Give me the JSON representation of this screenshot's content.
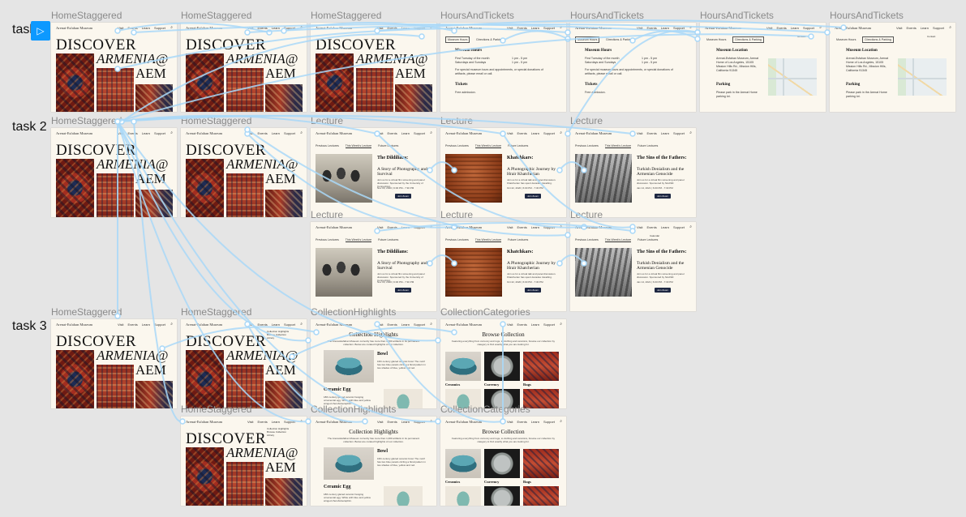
{
  "rows": [
    {
      "id": "task1",
      "label": "task 1"
    },
    {
      "id": "task2",
      "label": "task 2"
    },
    {
      "id": "task3",
      "label": "task 3"
    }
  ],
  "site": {
    "brand": "Arenat-Esfahan Museum",
    "nav": [
      "Visit",
      "Events",
      "Learn",
      "Support"
    ],
    "search_icon": "search-icon"
  },
  "home": {
    "line1": "DISCOVER",
    "line2": "ARMENIA@",
    "line3": "AEM"
  },
  "hours": {
    "tabs": [
      "Museum Hours",
      "Directions & Parking"
    ],
    "museum_hours_title": "Museum Hours",
    "row1_label": "First Tuesday of the month",
    "row1_time": "1 pm - 5 pm",
    "row2_label": "Saturdays and Sundays",
    "row2_time": "1 pm - 5 pm",
    "note": "For special museum tours and appointments, or special donations of artifacts, please email or call.",
    "tickets_title": "Tickets",
    "tickets_text": "Free admission.",
    "location_title": "Museum Location",
    "location_text": "Arenat-Esfahan Museum, Arenat Home of Los Angeles, 15105 Mission Hills Rd., Mission Hills, California 91345",
    "parking_title": "Parking",
    "parking_text": "Please park in the Arenat Home parking lot."
  },
  "lecture": {
    "tabs": [
      "Previous Lectures",
      "This Week's Lecture",
      "Future Lectures"
    ],
    "join": "Join Zoom",
    "items": [
      {
        "title": "The Dildilians:",
        "subtitle": "A Story of Photography and Survival",
        "date": "Nov 03, 2020 | 6:00 PM - 7:30 PM",
        "body": "Join us for a virtual film screening and panel discussion. Sponsored by the University of Connecticut."
      },
      {
        "title": "Khatchkars:",
        "subtitle": "A Photographic Journey by Hrair Khatcherian",
        "date": "Oct 22, 2020 | 6:00 PM - 7:30 PM",
        "body": "Join us for a virtual talk and panel discussion. Khatcherian has spent decades travelling."
      },
      {
        "title": "The Sins of the Fathers:",
        "subtitle": "Turkish Denialism and the Armenian Genocide",
        "date": "Jan 14, 2021 | 6:00 PM - 7:30 PM",
        "body": "Join us for a virtual film screening and panel discussion. Sponsored by NAASR."
      }
    ]
  },
  "collection": {
    "highlights_title": "Collection Highlights",
    "highlights_intro": "The Arenat-Esfahan Museum currently has more than 1,000 artifacts in its permanent collection. Below are curated highlights of our collection.",
    "items": [
      {
        "name": "Bowl",
        "text": "16th century glazed ceramic bowl. The motif has two blue panels circling a floral pattern in two shades of blue, yellow and red."
      },
      {
        "name": "Ceramic Egg",
        "text": "18th century glazed ceramic hanging ornamental egg. White with blue and yellow winged cherubs/seraphim."
      }
    ],
    "browse_title": "Browse Collection",
    "browse_intro": "Featuring everything from currency and rugs, to clothing and ceramics, browse our collection by category to find exactly what you are looking for.",
    "categories": [
      "Ceramics",
      "Currency",
      "Rugs"
    ],
    "learn_menu": [
      "Collection Highlights",
      "Browse Collection",
      "Library"
    ]
  },
  "events_menu": [
    "Calendar"
  ],
  "support_menu": [
    "Contact"
  ],
  "frames": [
    {
      "title": "HomeStaggered",
      "type": "home"
    },
    {
      "title": "HomeStaggered",
      "type": "home"
    },
    {
      "title": "HomeStaggered",
      "type": "home"
    },
    {
      "title": "HoursAndTickets",
      "type": "hours"
    },
    {
      "title": "HoursAndTickets",
      "type": "hours"
    },
    {
      "title": "HoursAndTickets",
      "type": "location"
    },
    {
      "title": "HoursAndTickets",
      "type": "location"
    },
    {
      "title": "HomeStaggered",
      "type": "home"
    },
    {
      "title": "HomeStaggered",
      "type": "home"
    },
    {
      "title": "Lecture",
      "type": "lecture",
      "item": 0
    },
    {
      "title": "Lecture",
      "type": "lecture",
      "item": 1
    },
    {
      "title": "Lecture",
      "type": "lecture",
      "item": 2
    },
    {
      "title": "Lecture",
      "type": "lecture",
      "item": 0
    },
    {
      "title": "Lecture",
      "type": "lecture",
      "item": 1
    },
    {
      "title": "Lecture",
      "type": "lecture",
      "item": 2
    },
    {
      "title": "HomeStaggered",
      "type": "home"
    },
    {
      "title": "HomeStaggered",
      "type": "home"
    },
    {
      "title": "CollectionHighlights",
      "type": "highlights"
    },
    {
      "title": "CollectionCategories",
      "type": "categories"
    },
    {
      "title": "HomeStaggered",
      "type": "home"
    },
    {
      "title": "CollectionHighlights",
      "type": "highlights"
    },
    {
      "title": "CollectionCategories",
      "type": "categories"
    }
  ],
  "colors": {
    "canvas": "#e5e5e5",
    "frame_bg": "#fbf7ee",
    "connector": "#a9d8f8",
    "start_button": "#0d99ff",
    "join_button": "#1d2742"
  }
}
